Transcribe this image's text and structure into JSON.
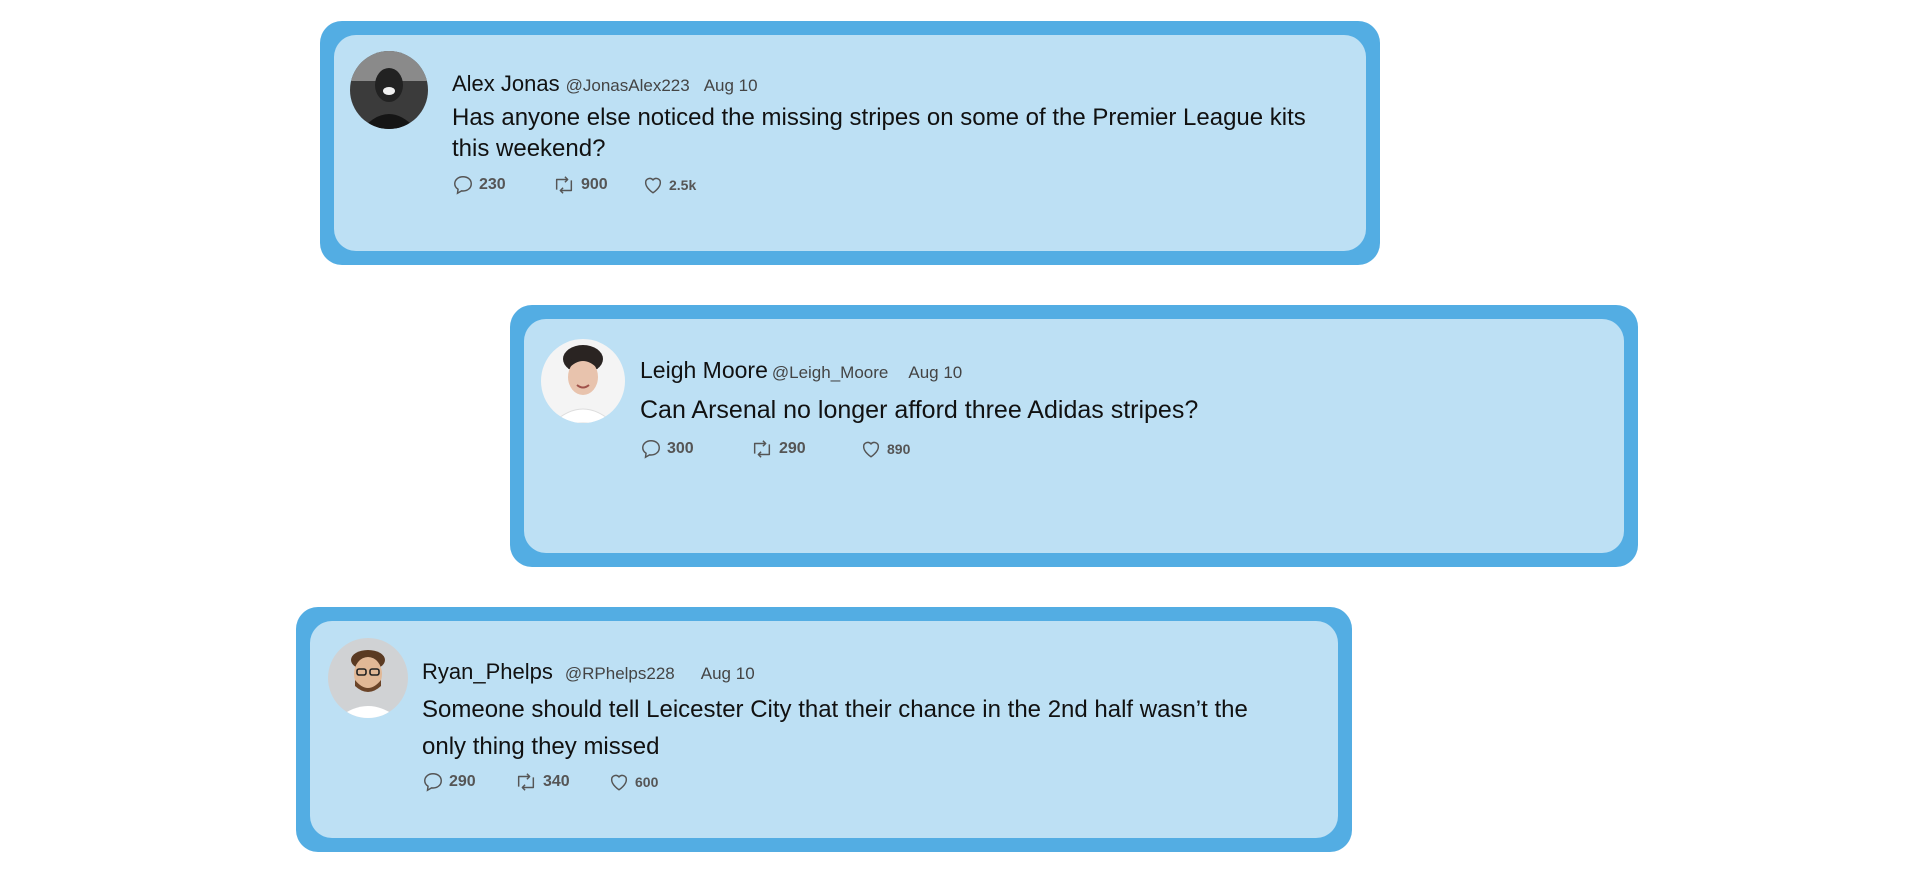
{
  "tweets": [
    {
      "name": "Alex Jonas",
      "handle": "@JonasAlex223",
      "date": "Aug 10",
      "text": "Has anyone else noticed the missing stripes on some of the Premier League kits this weekend?",
      "replies": "230",
      "retweets": "900",
      "likes": "2.5k"
    },
    {
      "name": "Leigh Moore",
      "handle": "@Leigh_Moore",
      "date": "Aug 10",
      "text": "Can Arsenal no longer afford three Adidas stripes?",
      "replies": "300",
      "retweets": "290",
      "likes": "890"
    },
    {
      "name": "Ryan_Phelps",
      "handle": "@RPhelps228",
      "date": "Aug 10",
      "text": "Someone should tell Leicester City that their chance in the 2nd half wasn’t the only thing they missed",
      "replies": "290",
      "retweets": "340",
      "likes": "600"
    }
  ],
  "icons": {
    "reply": "speech-bubble-icon",
    "retweet": "retweet-icon",
    "like": "heart-icon"
  },
  "colors": {
    "frame": "#53ade3",
    "card": "#bde0f4"
  }
}
